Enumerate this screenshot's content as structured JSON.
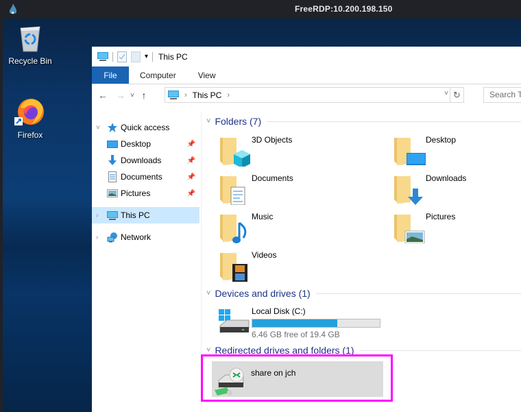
{
  "rdp": {
    "title": "FreeRDP:10.200.198.150"
  },
  "desktop": {
    "icons": [
      {
        "label": "Recycle Bin",
        "icon": "recycle-bin-icon"
      },
      {
        "label": "Firefox",
        "icon": "firefox-icon"
      }
    ]
  },
  "explorer": {
    "window_title": "This PC",
    "ribbon_tabs": [
      "File",
      "Computer",
      "View"
    ],
    "nav": {
      "back": "←",
      "forward": "→",
      "recent": "˅",
      "up": "↑",
      "address_crumb": "This PC",
      "address_sep": "›",
      "dropdown": "˅",
      "refresh": "↻",
      "search_placeholder": "Search This PC"
    },
    "navpane": {
      "quick_access": "Quick access",
      "quick_items": [
        {
          "label": "Desktop",
          "icon": "desktop-icon",
          "pinned": true
        },
        {
          "label": "Downloads",
          "icon": "downloads-icon",
          "pinned": true
        },
        {
          "label": "Documents",
          "icon": "documents-icon",
          "pinned": true
        },
        {
          "label": "Pictures",
          "icon": "pictures-icon",
          "pinned": true
        }
      ],
      "this_pc": "This PC",
      "network": "Network"
    },
    "groups": {
      "folders": {
        "title": "Folders (7)",
        "items": [
          "3D Objects",
          "Desktop",
          "Documents",
          "Downloads",
          "Music",
          "Pictures",
          "Videos"
        ]
      },
      "devices": {
        "title": "Devices and drives (1)",
        "drive": {
          "name": "Local Disk (C:)",
          "free_text": "6.46 GB free of 19.4 GB",
          "used_fraction": 0.667
        }
      },
      "redirected": {
        "title": "Redirected drives and folders (1)",
        "item": "share on jch"
      }
    }
  },
  "colors": {
    "file_tab": "#1a64b4",
    "selected": "#cce8ff",
    "group_header": "#1e3287",
    "drive_fill": "#26a0da",
    "highlight": "#ff00ff"
  }
}
